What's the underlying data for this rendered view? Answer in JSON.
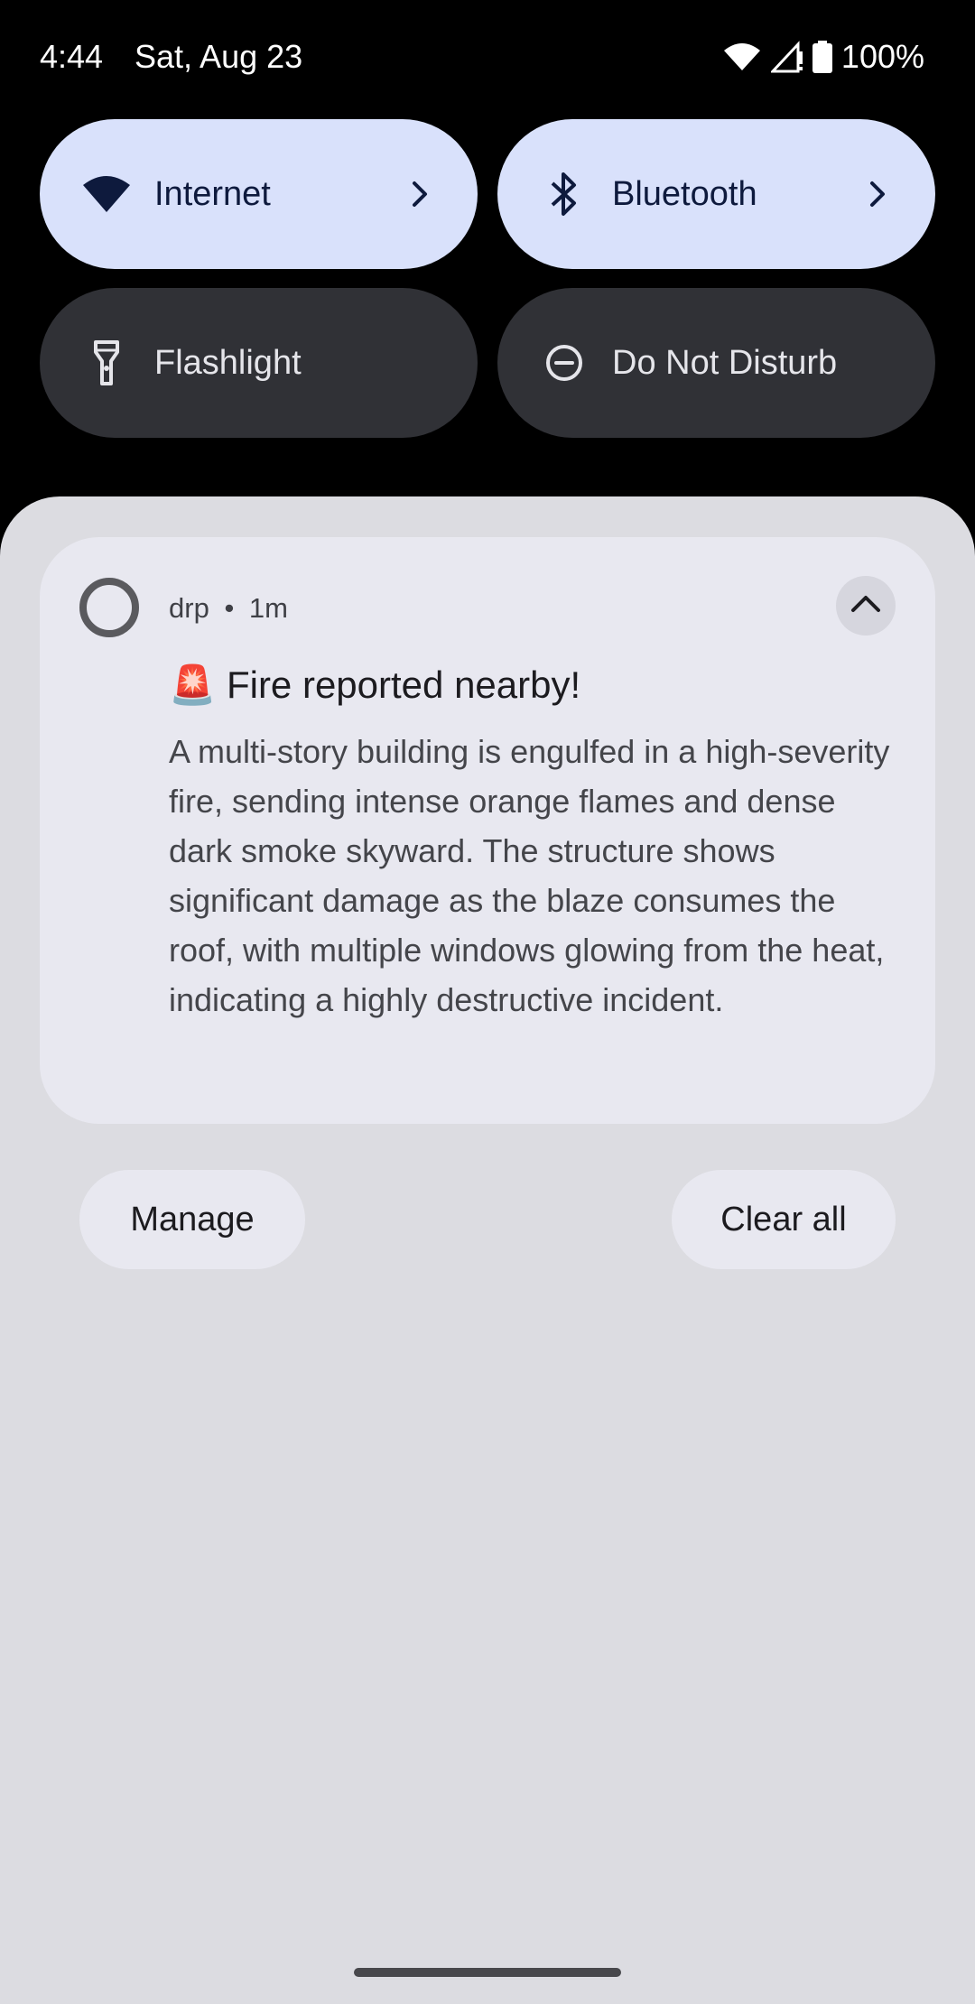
{
  "status_bar": {
    "time": "4:44",
    "date": "Sat, Aug 23",
    "battery": "100%",
    "icons": [
      "wifi-icon",
      "cell-signal-icon",
      "battery-icon"
    ]
  },
  "quick_settings": {
    "tiles": [
      {
        "label": "Internet",
        "icon": "wifi-icon",
        "state": "on"
      },
      {
        "label": "Bluetooth",
        "icon": "bluetooth-icon",
        "state": "on"
      },
      {
        "label": "Flashlight",
        "icon": "flashlight-icon",
        "state": "off"
      },
      {
        "label": "Do Not Disturb",
        "icon": "do-not-disturb-icon",
        "state": "off"
      }
    ]
  },
  "notification": {
    "app_name": "drp",
    "time_ago": "1m",
    "title": "🚨 Fire reported nearby!",
    "body": "A multi-story building is engulfed in a high-severity fire, sending intense orange flames and dense dark smoke skyward. The structure shows significant damage as the blaze consumes the roof, with multiple windows glowing from the heat, indicating a highly destructive incident."
  },
  "actions": {
    "manage_label": "Manage",
    "clear_all_label": "Clear all"
  },
  "colors": {
    "tile_on_bg": "#d9e1fb",
    "tile_off_bg": "#303136",
    "shade_bg": "#dcdce1",
    "card_bg": "#e8e8f0"
  }
}
